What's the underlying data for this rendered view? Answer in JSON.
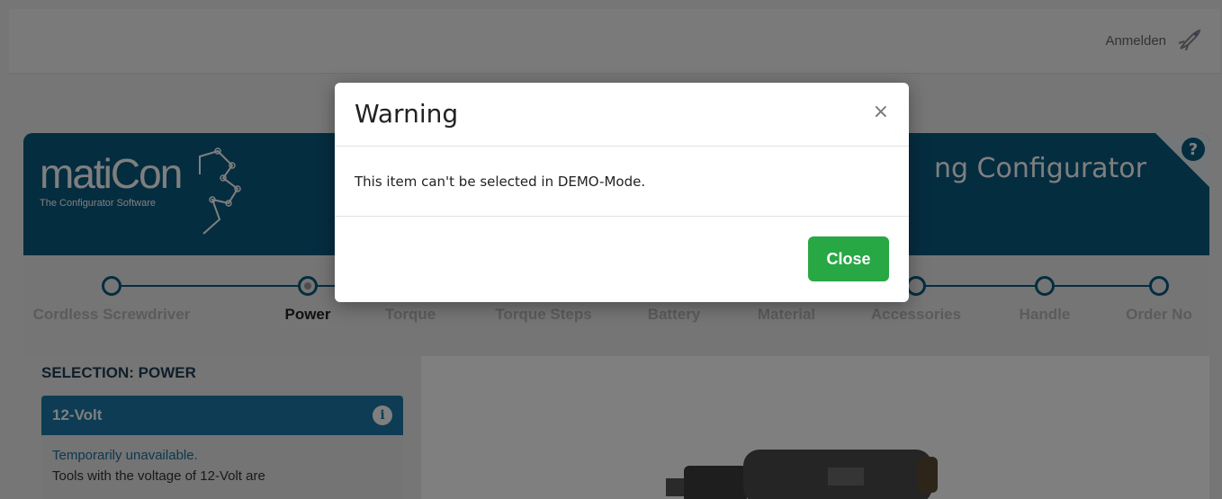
{
  "topbar": {
    "login_label": "Anmelden",
    "login_icon": "rocket-icon"
  },
  "header": {
    "logo_word": "matiCon",
    "logo_sub": "The Configurator Software",
    "title": "ng Configurator",
    "help_icon": "help-icon"
  },
  "stepper": {
    "steps": [
      {
        "label": "Cordless Screwdriver"
      },
      {
        "label": "Power"
      },
      {
        "label": "Torque"
      },
      {
        "label": "Torque Steps"
      },
      {
        "label": "Battery"
      },
      {
        "label": "Material"
      },
      {
        "label": "Accessories"
      },
      {
        "label": "Handle"
      },
      {
        "label": "Order No"
      }
    ],
    "active_index": 1
  },
  "selection": {
    "title": "SELECTION: POWER",
    "option": {
      "name": "12-Volt",
      "status": "Temporarily unavailable.",
      "description": "Tools with the voltage of 12-Volt are"
    }
  },
  "modal": {
    "title": "Warning",
    "close_glyph": "×",
    "message": "This item can't be selected in DEMO-Mode.",
    "close_button": "Close"
  },
  "colors": {
    "brand": "#0b5a80",
    "option_head": "#1a79a8",
    "success": "#28a745"
  }
}
